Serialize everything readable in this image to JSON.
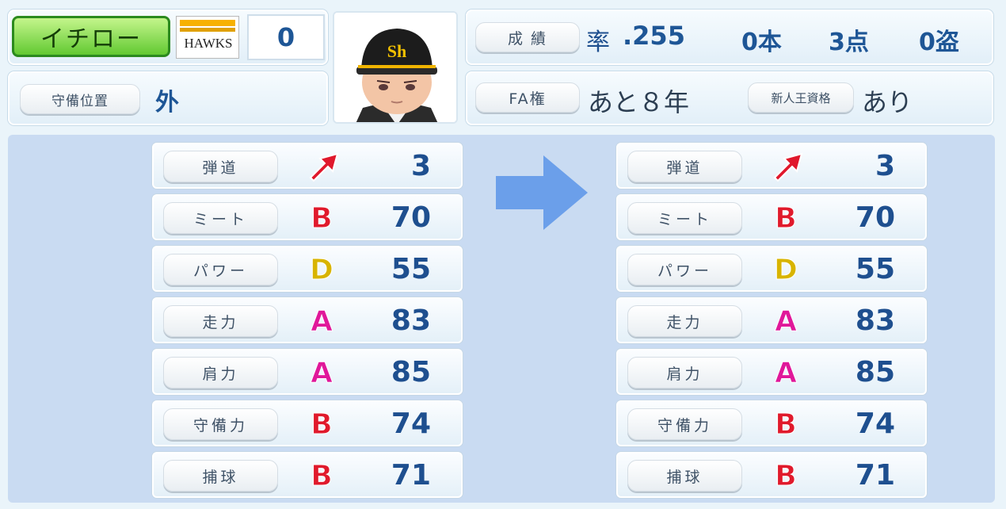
{
  "player": {
    "name": "イチロー",
    "team_logo_text": "HAWKS",
    "number": "0",
    "position_label": "守備位置",
    "position_value": "外"
  },
  "record": {
    "label": "成 績",
    "avg_label": "率",
    "avg": ".255",
    "hr": "0本",
    "rbi": "3点",
    "sb": "0盗"
  },
  "fa": {
    "label": "FA権",
    "value": "あと８年",
    "rookie_label": "新人王資格",
    "rookie_value": "あり"
  },
  "colors": {
    "grade_A": "#e0189a",
    "grade_B": "#e01a2c",
    "grade_D": "#d8b400",
    "trajectory_arrow": "#e0182c",
    "transition_arrow": "#6b9fea"
  },
  "before": [
    {
      "label": "弾道",
      "grade": "",
      "grade_color": "",
      "value": "3",
      "icon": "trajectory-arrow-icon"
    },
    {
      "label": "ミート",
      "grade": "B",
      "grade_color": "#e01a2c",
      "value": "70"
    },
    {
      "label": "パワー",
      "grade": "D",
      "grade_color": "#d8b400",
      "value": "55"
    },
    {
      "label": "走力",
      "grade": "A",
      "grade_color": "#e0189a",
      "value": "83"
    },
    {
      "label": "肩力",
      "grade": "A",
      "grade_color": "#e0189a",
      "value": "85"
    },
    {
      "label": "守備力",
      "grade": "B",
      "grade_color": "#e01a2c",
      "value": "74"
    },
    {
      "label": "捕球",
      "grade": "B",
      "grade_color": "#e01a2c",
      "value": "71"
    }
  ],
  "after": [
    {
      "label": "弾道",
      "grade": "",
      "grade_color": "",
      "value": "3",
      "icon": "trajectory-arrow-icon"
    },
    {
      "label": "ミート",
      "grade": "B",
      "grade_color": "#e01a2c",
      "value": "70"
    },
    {
      "label": "パワー",
      "grade": "D",
      "grade_color": "#d8b400",
      "value": "55"
    },
    {
      "label": "走力",
      "grade": "A",
      "grade_color": "#e0189a",
      "value": "83"
    },
    {
      "label": "肩力",
      "grade": "A",
      "grade_color": "#e0189a",
      "value": "85"
    },
    {
      "label": "守備力",
      "grade": "B",
      "grade_color": "#e01a2c",
      "value": "74"
    },
    {
      "label": "捕球",
      "grade": "B",
      "grade_color": "#e01a2c",
      "value": "71"
    }
  ]
}
